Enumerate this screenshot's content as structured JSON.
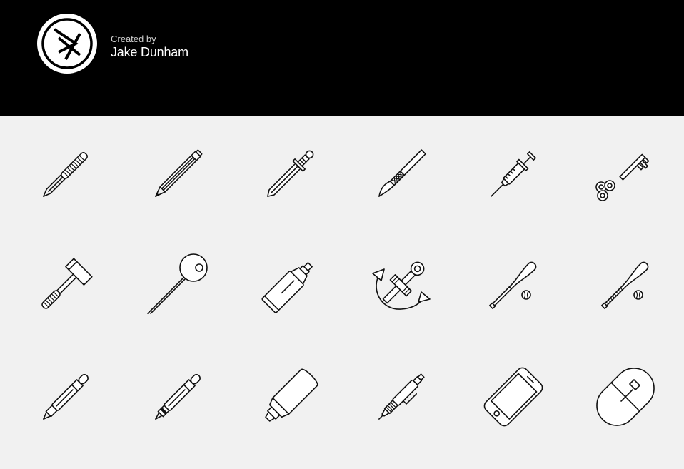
{
  "header": {
    "credit_line": "Created by",
    "author_name": "Jake Dunham",
    "background": "#000000"
  },
  "icons": [
    "utility-knife-icon",
    "pencil-icon",
    "sword-icon",
    "scalpel-icon",
    "syringe-icon",
    "key-icon",
    "hammer-icon",
    "pin-icon",
    "spray-can-icon",
    "anchor-icon",
    "baseball-bat-icon",
    "baseball-bat-grip-icon",
    "pen-icon",
    "marker-pen-icon",
    "highlighter-icon",
    "mechanical-pencil-icon",
    "smartphone-icon",
    "mouse-icon"
  ]
}
